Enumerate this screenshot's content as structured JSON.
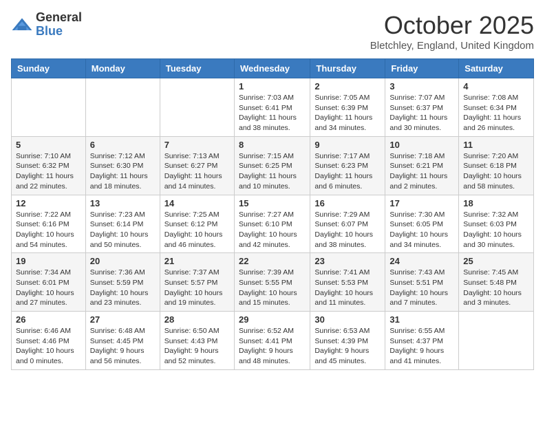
{
  "logo": {
    "general": "General",
    "blue": "Blue"
  },
  "title": "October 2025",
  "location": "Bletchley, England, United Kingdom",
  "days_header": [
    "Sunday",
    "Monday",
    "Tuesday",
    "Wednesday",
    "Thursday",
    "Friday",
    "Saturday"
  ],
  "weeks": [
    [
      {
        "day": "",
        "info": ""
      },
      {
        "day": "",
        "info": ""
      },
      {
        "day": "",
        "info": ""
      },
      {
        "day": "1",
        "info": "Sunrise: 7:03 AM\nSunset: 6:41 PM\nDaylight: 11 hours\nand 38 minutes."
      },
      {
        "day": "2",
        "info": "Sunrise: 7:05 AM\nSunset: 6:39 PM\nDaylight: 11 hours\nand 34 minutes."
      },
      {
        "day": "3",
        "info": "Sunrise: 7:07 AM\nSunset: 6:37 PM\nDaylight: 11 hours\nand 30 minutes."
      },
      {
        "day": "4",
        "info": "Sunrise: 7:08 AM\nSunset: 6:34 PM\nDaylight: 11 hours\nand 26 minutes."
      }
    ],
    [
      {
        "day": "5",
        "info": "Sunrise: 7:10 AM\nSunset: 6:32 PM\nDaylight: 11 hours\nand 22 minutes."
      },
      {
        "day": "6",
        "info": "Sunrise: 7:12 AM\nSunset: 6:30 PM\nDaylight: 11 hours\nand 18 minutes."
      },
      {
        "day": "7",
        "info": "Sunrise: 7:13 AM\nSunset: 6:27 PM\nDaylight: 11 hours\nand 14 minutes."
      },
      {
        "day": "8",
        "info": "Sunrise: 7:15 AM\nSunset: 6:25 PM\nDaylight: 11 hours\nand 10 minutes."
      },
      {
        "day": "9",
        "info": "Sunrise: 7:17 AM\nSunset: 6:23 PM\nDaylight: 11 hours\nand 6 minutes."
      },
      {
        "day": "10",
        "info": "Sunrise: 7:18 AM\nSunset: 6:21 PM\nDaylight: 11 hours\nand 2 minutes."
      },
      {
        "day": "11",
        "info": "Sunrise: 7:20 AM\nSunset: 6:18 PM\nDaylight: 10 hours\nand 58 minutes."
      }
    ],
    [
      {
        "day": "12",
        "info": "Sunrise: 7:22 AM\nSunset: 6:16 PM\nDaylight: 10 hours\nand 54 minutes."
      },
      {
        "day": "13",
        "info": "Sunrise: 7:23 AM\nSunset: 6:14 PM\nDaylight: 10 hours\nand 50 minutes."
      },
      {
        "day": "14",
        "info": "Sunrise: 7:25 AM\nSunset: 6:12 PM\nDaylight: 10 hours\nand 46 minutes."
      },
      {
        "day": "15",
        "info": "Sunrise: 7:27 AM\nSunset: 6:10 PM\nDaylight: 10 hours\nand 42 minutes."
      },
      {
        "day": "16",
        "info": "Sunrise: 7:29 AM\nSunset: 6:07 PM\nDaylight: 10 hours\nand 38 minutes."
      },
      {
        "day": "17",
        "info": "Sunrise: 7:30 AM\nSunset: 6:05 PM\nDaylight: 10 hours\nand 34 minutes."
      },
      {
        "day": "18",
        "info": "Sunrise: 7:32 AM\nSunset: 6:03 PM\nDaylight: 10 hours\nand 30 minutes."
      }
    ],
    [
      {
        "day": "19",
        "info": "Sunrise: 7:34 AM\nSunset: 6:01 PM\nDaylight: 10 hours\nand 27 minutes."
      },
      {
        "day": "20",
        "info": "Sunrise: 7:36 AM\nSunset: 5:59 PM\nDaylight: 10 hours\nand 23 minutes."
      },
      {
        "day": "21",
        "info": "Sunrise: 7:37 AM\nSunset: 5:57 PM\nDaylight: 10 hours\nand 19 minutes."
      },
      {
        "day": "22",
        "info": "Sunrise: 7:39 AM\nSunset: 5:55 PM\nDaylight: 10 hours\nand 15 minutes."
      },
      {
        "day": "23",
        "info": "Sunrise: 7:41 AM\nSunset: 5:53 PM\nDaylight: 10 hours\nand 11 minutes."
      },
      {
        "day": "24",
        "info": "Sunrise: 7:43 AM\nSunset: 5:51 PM\nDaylight: 10 hours\nand 7 minutes."
      },
      {
        "day": "25",
        "info": "Sunrise: 7:45 AM\nSunset: 5:48 PM\nDaylight: 10 hours\nand 3 minutes."
      }
    ],
    [
      {
        "day": "26",
        "info": "Sunrise: 6:46 AM\nSunset: 4:46 PM\nDaylight: 10 hours\nand 0 minutes."
      },
      {
        "day": "27",
        "info": "Sunrise: 6:48 AM\nSunset: 4:45 PM\nDaylight: 9 hours\nand 56 minutes."
      },
      {
        "day": "28",
        "info": "Sunrise: 6:50 AM\nSunset: 4:43 PM\nDaylight: 9 hours\nand 52 minutes."
      },
      {
        "day": "29",
        "info": "Sunrise: 6:52 AM\nSunset: 4:41 PM\nDaylight: 9 hours\nand 48 minutes."
      },
      {
        "day": "30",
        "info": "Sunrise: 6:53 AM\nSunset: 4:39 PM\nDaylight: 9 hours\nand 45 minutes."
      },
      {
        "day": "31",
        "info": "Sunrise: 6:55 AM\nSunset: 4:37 PM\nDaylight: 9 hours\nand 41 minutes."
      },
      {
        "day": "",
        "info": ""
      }
    ]
  ]
}
